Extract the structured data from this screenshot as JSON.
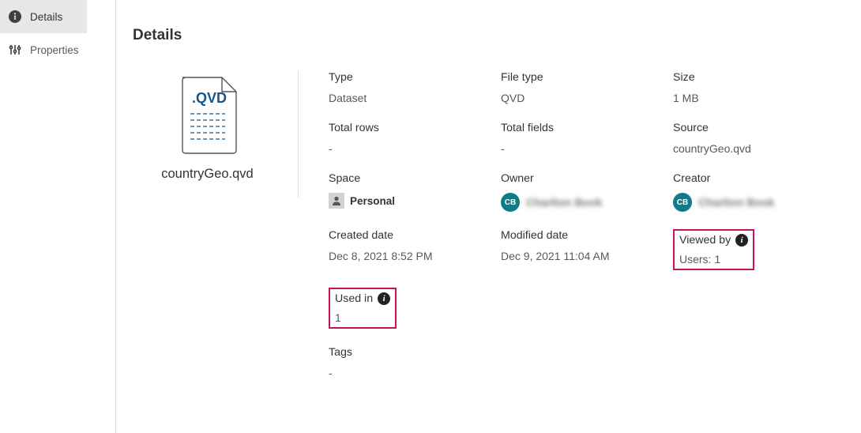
{
  "sidebar": {
    "items": [
      {
        "label": "Details"
      },
      {
        "label": "Properties"
      }
    ]
  },
  "page": {
    "title": "Details"
  },
  "file": {
    "name": "countryGeo.qvd",
    "ext_label": ".QVD"
  },
  "meta": {
    "type": {
      "label": "Type",
      "value": "Dataset"
    },
    "fileType": {
      "label": "File type",
      "value": "QVD"
    },
    "size": {
      "label": "Size",
      "value": "1 MB"
    },
    "totalRows": {
      "label": "Total rows",
      "value": "-"
    },
    "totalFields": {
      "label": "Total fields",
      "value": "-"
    },
    "source": {
      "label": "Source",
      "value": "countryGeo.qvd"
    },
    "space": {
      "label": "Space",
      "value": "Personal"
    },
    "owner": {
      "label": "Owner",
      "initials": "CB",
      "name": "Charlton Book"
    },
    "creator": {
      "label": "Creator",
      "initials": "CB",
      "name": "Charlton Book"
    },
    "createdDate": {
      "label": "Created date",
      "value": "Dec 8, 2021 8:52 PM"
    },
    "modifiedDate": {
      "label": "Modified date",
      "value": "Dec 9, 2021 11:04 AM"
    },
    "viewedBy": {
      "label": "Viewed by",
      "value": "Users: 1"
    },
    "usedIn": {
      "label": "Used in",
      "value": "1"
    },
    "tags": {
      "label": "Tags",
      "value": "-"
    }
  }
}
